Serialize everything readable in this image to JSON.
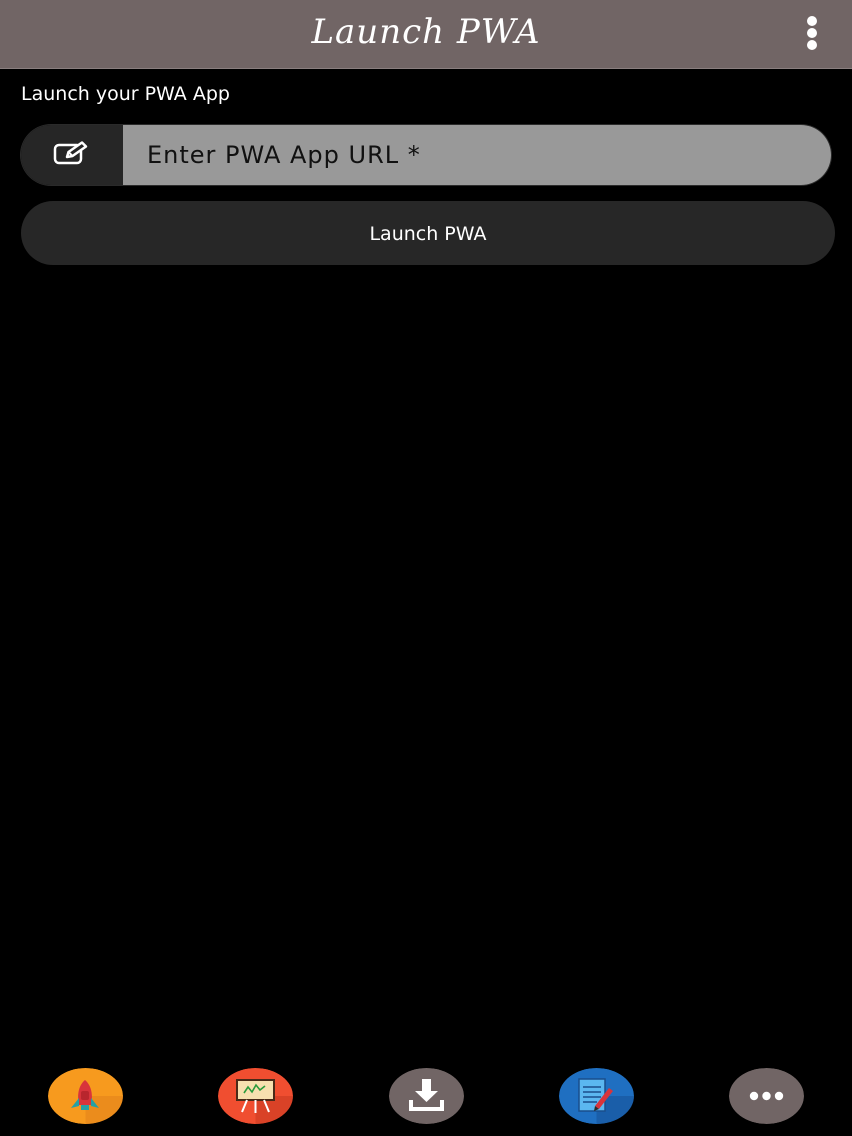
{
  "header": {
    "title": "Launch PWA",
    "menu_icon": "more-vertical-icon"
  },
  "form": {
    "section_label": "Launch your PWA App",
    "url_input": {
      "placeholder": "Enter PWA App URL *",
      "value": "",
      "icon": "edit-icon"
    },
    "launch_button_label": "Launch PWA"
  },
  "bottom_nav": {
    "items": [
      {
        "id": "launch",
        "icon": "rocket-icon",
        "color": "#f79a1e"
      },
      {
        "id": "presentation",
        "icon": "presentation-board-icon",
        "color": "#f04e30"
      },
      {
        "id": "download",
        "icon": "download-icon",
        "color": "#716565"
      },
      {
        "id": "notes",
        "icon": "notepad-icon",
        "color": "#1f6fc1"
      },
      {
        "id": "more",
        "icon": "more-horizontal-icon",
        "color": "#716565"
      }
    ]
  },
  "colors": {
    "header_bg": "#716565",
    "page_bg": "#000000",
    "input_bg": "#999999",
    "button_bg": "#272727"
  }
}
